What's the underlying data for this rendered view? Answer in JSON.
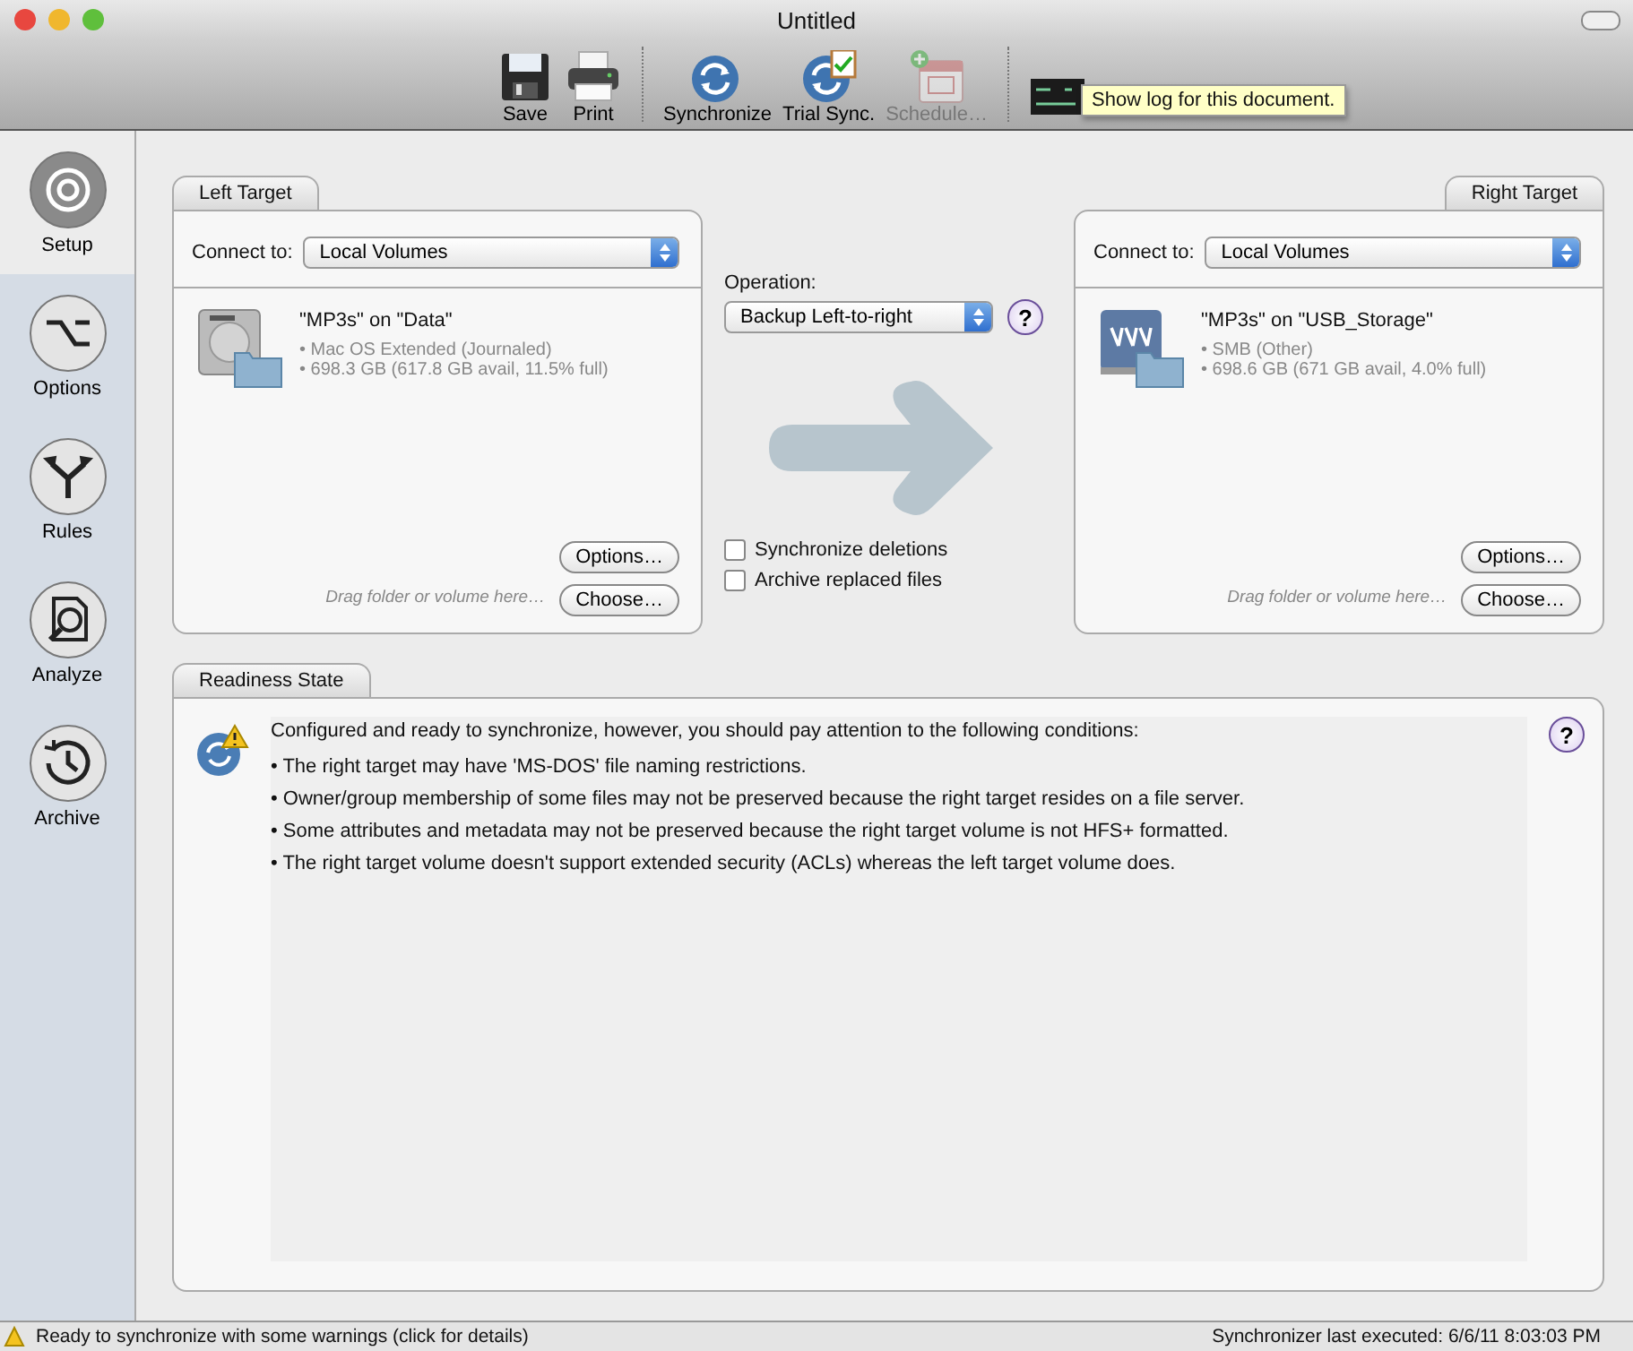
{
  "window": {
    "title": "Untitled"
  },
  "toolbar_groups": [
    [
      {
        "kind": "save",
        "label": "Save",
        "disabled": false
      },
      {
        "kind": "print",
        "label": "Print",
        "disabled": false
      }
    ],
    [
      {
        "kind": "sync",
        "label": "Synchronize",
        "disabled": false
      },
      {
        "kind": "trial",
        "label": "Trial Sync.",
        "disabled": false
      },
      {
        "kind": "schedule",
        "label": "Schedule…",
        "disabled": true
      }
    ],
    [
      {
        "kind": "log",
        "disabled": false
      }
    ]
  ],
  "tooltip": "Show log for this document.",
  "sidebar": [
    {
      "kind": "setup",
      "label": "Setup",
      "selected": true
    },
    {
      "kind": "options",
      "label": "Options",
      "selected": false
    },
    {
      "kind": "rules",
      "label": "Rules",
      "selected": false
    },
    {
      "kind": "analyze",
      "label": "Analyze",
      "selected": false
    },
    {
      "kind": "archive",
      "label": "Archive",
      "selected": false
    }
  ],
  "targets": [
    {
      "tab": "Left Target",
      "connect_label": "Connect to:",
      "connect_value": "Local Volumes",
      "volume": {
        "kind": "disk",
        "name": "\"MP3s\" on \"Data\"",
        "details": [
          "• Mac OS Extended (Journaled)",
          "• 698.3 GB (617.8 GB avail, 11.5% full)"
        ]
      },
      "drop_hint": "Drag folder or volume here…",
      "buttons": [
        "Options…",
        "Choose…"
      ]
    },
    {
      "tab": "Right Target",
      "connect_label": "Connect to:",
      "connect_value": "Local Volumes",
      "volume": {
        "kind": "network",
        "name": "\"MP3s\" on \"USB_Storage\"",
        "details": [
          "• SMB (Other)",
          "• 698.6 GB (671 GB avail, 4.0% full)"
        ]
      },
      "drop_hint": "Drag folder or volume here…",
      "buttons": [
        "Options…",
        "Choose…"
      ]
    }
  ],
  "operation": {
    "label": "Operation:",
    "value": "Backup Left-to-right",
    "help": "?"
  },
  "operation_options": [
    {
      "label": "Synchronize deletions",
      "checked": false
    },
    {
      "label": "Archive replaced files",
      "checked": false
    }
  ],
  "readiness": {
    "tab": "Readiness State",
    "message": "Configured and ready to synchronize, however, you should pay attention to the following conditions:",
    "help": "?",
    "conditions": [
      "• The right target may have 'MS-DOS' file naming restrictions.",
      "• Owner/group membership of some files may not be preserved because the right target resides on a file server.",
      "• Some attributes and metadata may not be preserved because the right target volume is not HFS+ formatted.",
      "• The right target volume doesn't support extended security (ACLs) whereas the left target volume does."
    ]
  },
  "status_bar": {
    "message": "Ready to synchronize with some warnings (click for details)",
    "last_executed": "Synchronizer last executed:  6/6/11 8:03:03 PM"
  }
}
